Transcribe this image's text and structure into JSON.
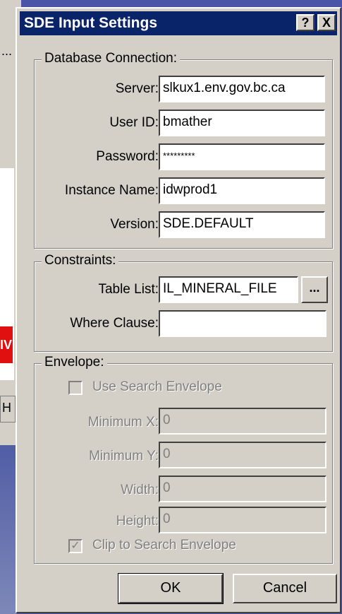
{
  "background": {
    "fragment_top": "...",
    "fragment_bottom": "H",
    "fragment_red": "IV"
  },
  "dialog": {
    "title": "SDE Input Settings",
    "help_label": "?",
    "close_label": "X"
  },
  "database_connection": {
    "legend": "Database Connection:",
    "server_label": "Server:",
    "server_value": "slkux1.env.gov.bc.ca",
    "userid_label": "User ID:",
    "userid_value": "bmather",
    "password_label": "Password:",
    "password_value": "*********",
    "instance_label": "Instance Name:",
    "instance_value": "idwprod1",
    "version_label": "Version:",
    "version_value": "SDE.DEFAULT"
  },
  "constraints": {
    "legend": "Constraints:",
    "table_list_label": "Table List:",
    "table_list_value": "IL_MINERAL_FILE",
    "browse_label": "...",
    "where_label": "Where Clause:",
    "where_value": ""
  },
  "envelope": {
    "legend": "Envelope:",
    "use_search_label": "Use Search Envelope",
    "use_search_checked": false,
    "min_x_label": "Minimum X:",
    "min_x_value": "0",
    "min_y_label": "Minimum Y:",
    "min_y_value": "0",
    "width_label": "Width:",
    "width_value": "0",
    "height_label": "Height:",
    "height_value": "0",
    "clip_label": "Clip to Search Envelope",
    "clip_checked": true,
    "check_mark": "✓"
  },
  "buttons": {
    "ok": "OK",
    "cancel": "Cancel"
  }
}
